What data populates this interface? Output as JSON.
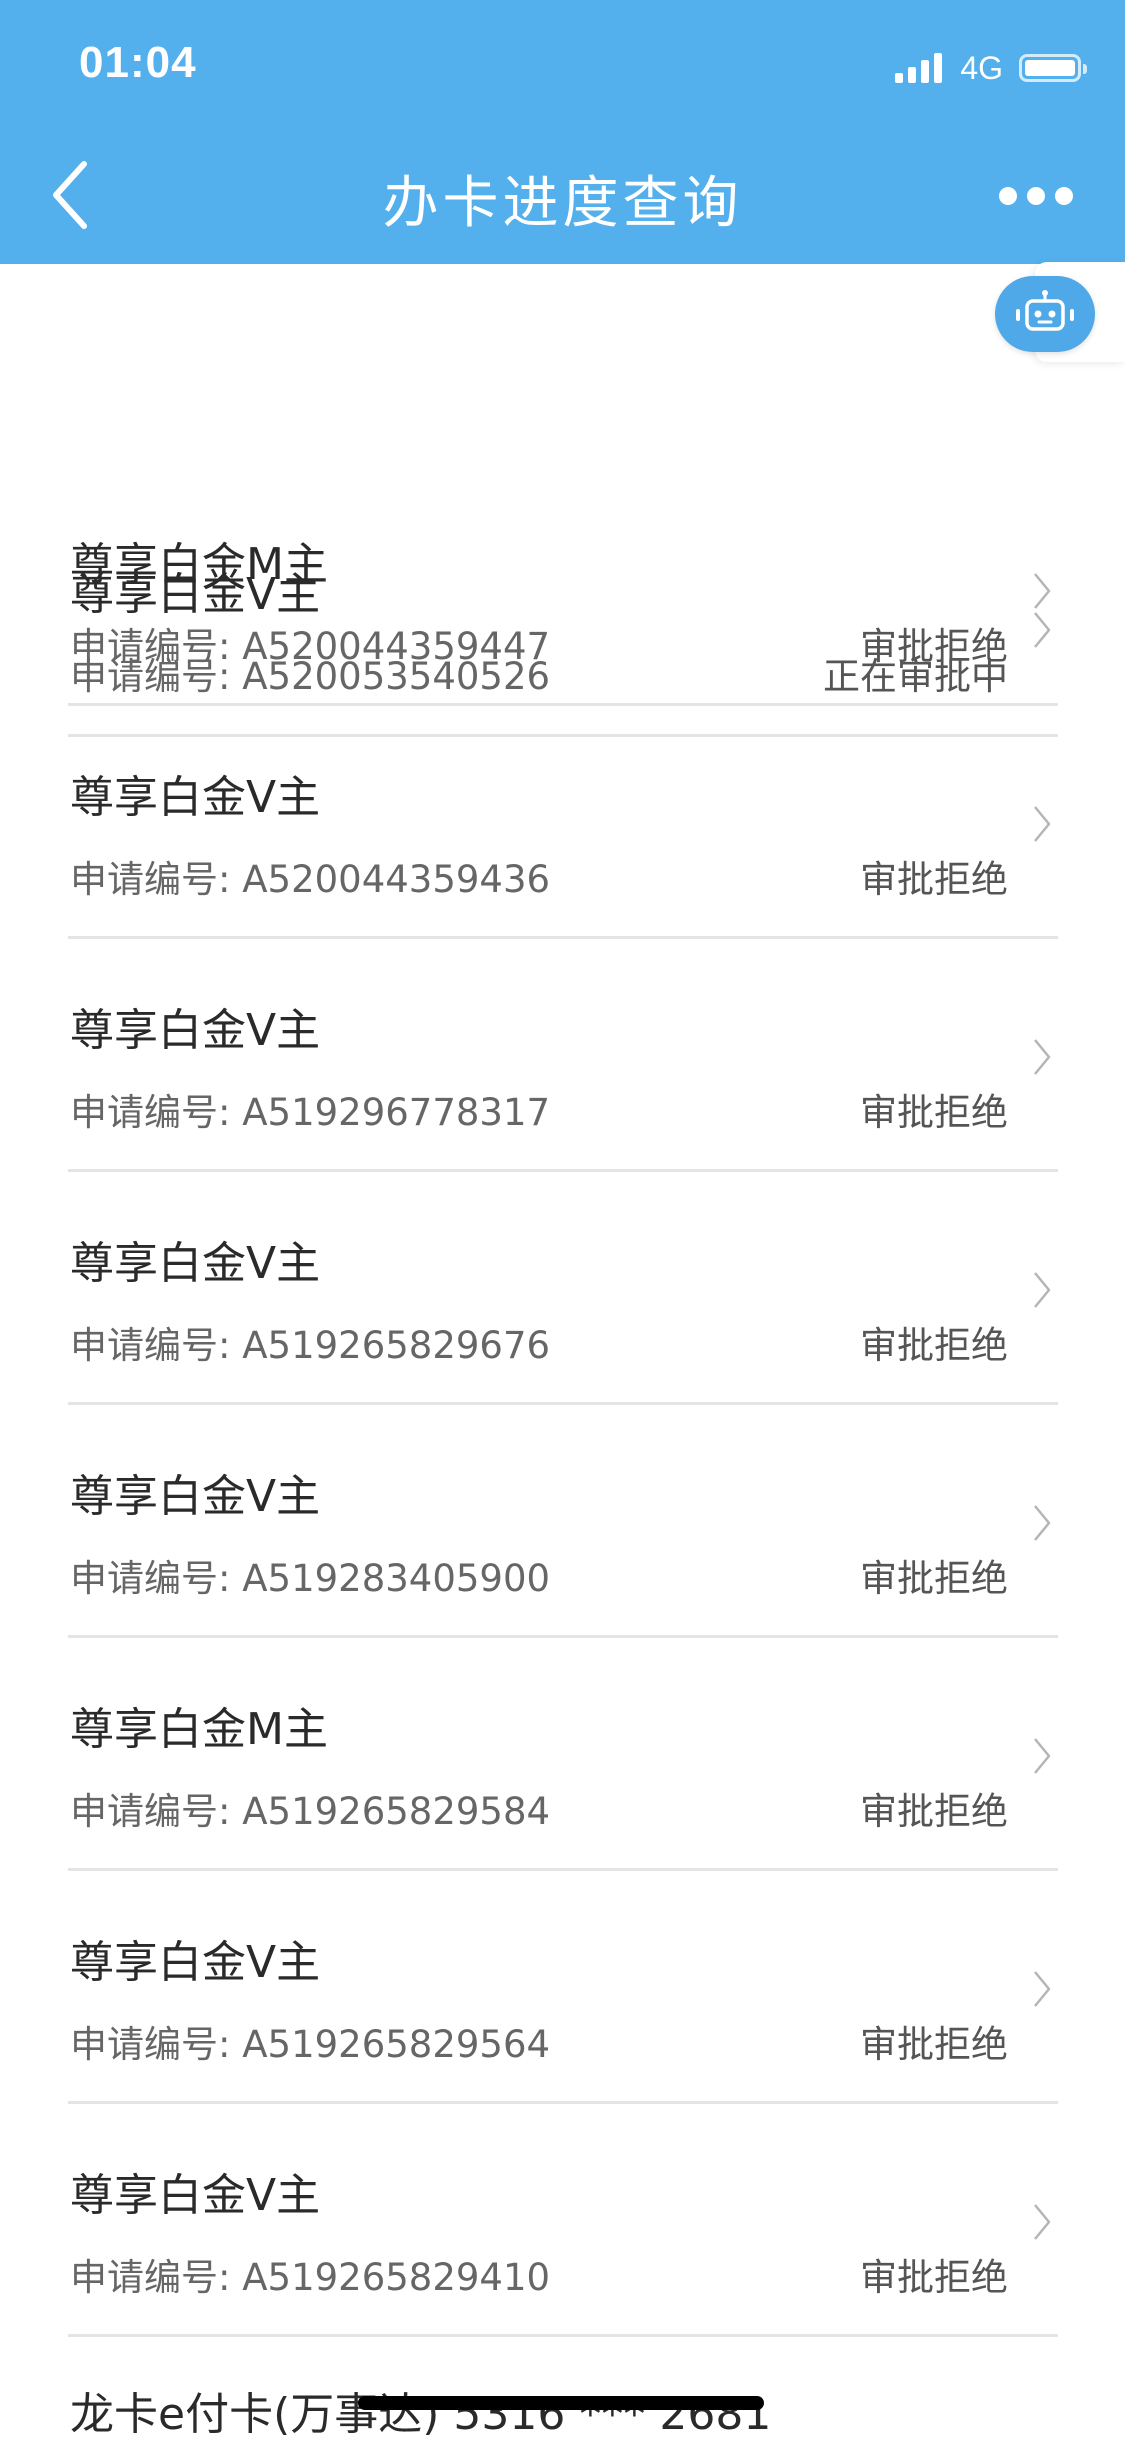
{
  "status_bar": {
    "time": "01:04",
    "network": "4G"
  },
  "nav": {
    "title": "办卡进度查询"
  },
  "list": {
    "sub_prefix": "申请编号: ",
    "items": [
      {
        "title": "尊享白金V主",
        "number": "A520053540526",
        "status": "正在审批中"
      },
      {
        "title": "尊享白金M主",
        "number": "A520044359447",
        "status": "审批拒绝"
      },
      {
        "title": "尊享白金V主",
        "number": "A520044359436",
        "status": "审批拒绝"
      },
      {
        "title": "尊享白金V主",
        "number": "A519296778317",
        "status": "审批拒绝"
      },
      {
        "title": "尊享白金V主",
        "number": "A519265829676",
        "status": "审批拒绝"
      },
      {
        "title": "尊享白金V主",
        "number": "A519283405900",
        "status": "审批拒绝"
      },
      {
        "title": "尊享白金M主",
        "number": "A519265829584",
        "status": "审批拒绝"
      },
      {
        "title": "尊享白金V主",
        "number": "A519265829564",
        "status": "审批拒绝"
      },
      {
        "title": "尊享白金V主",
        "number": "A519265829410",
        "status": "审批拒绝"
      }
    ],
    "partial_item_title": "龙卡e付卡(万事达) 5316 *** 2681"
  },
  "colors": {
    "header_bg": "#53b0ec",
    "robot_bg": "#4fa8e8",
    "divider": "#e4e4e4"
  },
  "icons": {
    "back": "back-arrow-icon",
    "more": "more-dots-icon",
    "assistant": "robot-icon",
    "row": "chevron-right-icon"
  }
}
